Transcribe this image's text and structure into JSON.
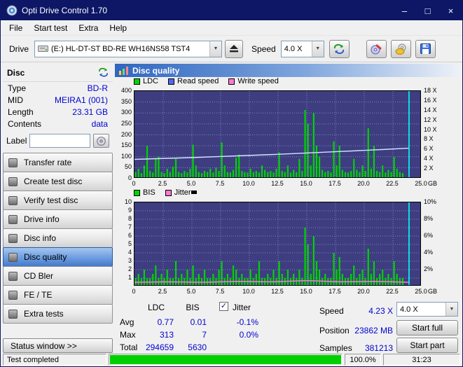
{
  "window": {
    "title": "Opti Drive Control 1.70",
    "minimize": "–",
    "maximize": "□",
    "close": "×"
  },
  "menu": {
    "items": [
      "File",
      "Start test",
      "Extra",
      "Help"
    ]
  },
  "toolbar": {
    "drive_label": "Drive",
    "drive_value": "(E:)  HL-DT-ST BD-RE  WH16NS58 TST4",
    "speed_label": "Speed",
    "speed_value": "4.0 X"
  },
  "sidebar": {
    "header": "Disc",
    "fields": [
      {
        "label": "Type",
        "value": "BD-R"
      },
      {
        "label": "MID",
        "value": "MEIRA1 (001)"
      },
      {
        "label": "Length",
        "value": "23.31 GB"
      },
      {
        "label": "Contents",
        "value": "data"
      }
    ],
    "label_field": {
      "label": "Label",
      "value": ""
    },
    "buttons": [
      {
        "label": "Transfer rate"
      },
      {
        "label": "Create test disc"
      },
      {
        "label": "Verify test disc"
      },
      {
        "label": "Drive info"
      },
      {
        "label": "Disc info"
      },
      {
        "label": "Disc quality",
        "selected": true
      },
      {
        "label": "CD Bler"
      },
      {
        "label": "FE / TE"
      },
      {
        "label": "Extra tests"
      }
    ],
    "status_window": "Status window >>"
  },
  "panel": {
    "title": "Disc quality"
  },
  "chart_data": [
    {
      "type": "bar",
      "name": "disc-quality-ldc",
      "legend": [
        {
          "label": "LDC",
          "color": "#00d400"
        },
        {
          "label": "Read speed",
          "color": "#5566ee"
        },
        {
          "label": "Write speed",
          "color": "#ff7ad2"
        }
      ],
      "xlim": [
        0,
        25
      ],
      "xticks": [
        0,
        2.5,
        5,
        7.5,
        10,
        12.5,
        15,
        17.5,
        20,
        22.5,
        25
      ],
      "x_unit": "GB",
      "left_axis": {
        "lim": [
          0,
          400
        ],
        "ticks": [
          0,
          50,
          100,
          150,
          200,
          250,
          300,
          350,
          400
        ],
        "suffix": ""
      },
      "right_axis": {
        "lim": [
          0,
          18
        ],
        "ticks": [
          2,
          4,
          6,
          8,
          10,
          12,
          14,
          16,
          18
        ],
        "suffix": " X"
      },
      "grid": {
        "x_step": 2.5,
        "y_step": 50
      },
      "bars": {
        "name": "LDC",
        "color": "#00d400",
        "x_start": 0.1,
        "x_step": 0.25,
        "values": [
          30,
          45,
          25,
          60,
          150,
          35,
          28,
          90,
          100,
          30,
          25,
          45,
          30,
          55,
          90,
          30,
          25,
          35,
          28,
          45,
          155,
          60,
          30,
          25,
          35,
          30,
          45,
          28,
          50,
          35,
          165,
          60,
          30,
          28,
          40,
          95,
          110,
          35,
          30,
          28,
          45,
          30,
          35,
          28,
          60,
          40,
          30,
          35,
          28,
          45,
          120,
          35,
          30,
          60,
          28,
          40,
          30,
          90,
          35,
          313,
          250,
          60,
          300,
          150,
          100,
          40,
          30,
          35,
          28,
          170,
          60,
          150,
          40,
          30,
          28,
          35,
          90,
          40,
          30,
          60,
          35,
          230,
          45,
          150,
          35,
          30,
          60,
          28,
          40,
          30,
          100,
          45,
          30,
          25
        ]
      },
      "lines": [
        {
          "name": "Read speed",
          "color": "#d2e4ff",
          "points": [
            [
              0,
              88
            ],
            [
              2.5,
              92
            ],
            [
              5,
              96
            ],
            [
              7.5,
              101
            ],
            [
              10,
              106
            ],
            [
              12.5,
              111
            ],
            [
              15,
              117
            ],
            [
              17.5,
              123
            ],
            [
              20,
              129
            ],
            [
              22,
              134
            ],
            [
              23.9,
              139
            ]
          ]
        }
      ],
      "end_line": {
        "x": 23.9,
        "color": "#00ffff"
      }
    },
    {
      "type": "bar",
      "name": "bis-jitter",
      "legend": [
        {
          "label": "BIS",
          "color": "#00d400"
        },
        {
          "label": "Jitter",
          "color": "#ff7ad2"
        }
      ],
      "xlim": [
        0,
        25
      ],
      "xticks": [
        0,
        2.5,
        5,
        7.5,
        10,
        12.5,
        15,
        17.5,
        20,
        22.5,
        25
      ],
      "x_unit": "GB",
      "left_axis": {
        "lim": [
          0,
          10
        ],
        "ticks": [
          1,
          2,
          3,
          4,
          5,
          6,
          7,
          8,
          9,
          10
        ],
        "suffix": ""
      },
      "right_axis": {
        "lim": [
          0,
          10
        ],
        "ticks": [
          2,
          4,
          6,
          8,
          10
        ],
        "suffix": "%"
      },
      "grid": {
        "x_step": 2.5,
        "y_step": 1
      },
      "bars": {
        "name": "BIS",
        "color": "#00d400",
        "x_start": 0.1,
        "x_step": 0.25,
        "values": [
          1,
          1.5,
          1,
          2,
          1,
          1,
          1.5,
          2.5,
          1,
          1.5,
          1,
          2,
          1,
          1,
          3,
          1,
          1.5,
          1,
          2,
          1,
          2.5,
          1,
          1.5,
          1,
          2,
          1,
          1,
          1.5,
          1,
          2,
          3,
          1,
          1.5,
          1,
          2.5,
          2,
          1,
          1.5,
          1,
          1,
          2,
          1,
          1.5,
          3,
          1,
          1,
          1.5,
          1,
          2,
          1,
          3,
          1.5,
          1,
          2,
          1,
          1.5,
          1,
          2,
          1,
          7,
          5,
          1.5,
          6,
          3,
          2,
          1,
          1.5,
          1,
          1,
          4,
          2,
          3.5,
          1.5,
          1,
          1,
          1.5,
          2.5,
          1,
          1.5,
          2,
          1,
          4.5,
          1.5,
          3,
          1,
          1.5,
          2,
          1,
          1.5,
          1,
          3,
          1.5,
          1,
          1
        ]
      },
      "lines": [
        {
          "name": "Jitter",
          "color": "#ff7ad2",
          "points": [
            [
              0,
              0.5
            ],
            [
              3,
              0.55
            ],
            [
              6,
              0.5
            ],
            [
              9,
              0.6
            ],
            [
              12,
              0.55
            ],
            [
              15,
              0.7
            ],
            [
              18,
              0.55
            ],
            [
              21,
              0.6
            ],
            [
              23.9,
              0.5
            ]
          ]
        }
      ],
      "end_line": {
        "x": 23.9,
        "color": "#00ffff"
      }
    }
  ],
  "stats": {
    "columns": {
      "ldc": "LDC",
      "bis": "BIS",
      "jitter": "Jitter"
    },
    "jitter_checked": true,
    "rows": [
      {
        "label": "Avg",
        "ldc": "0.77",
        "bis": "0.01",
        "jitter": "-0.1%"
      },
      {
        "label": "Max",
        "ldc": "313",
        "bis": "7",
        "jitter": "0.0%"
      },
      {
        "label": "Total",
        "ldc": "294659",
        "bis": "5630",
        "jitter": ""
      }
    ],
    "speed_label": "Speed",
    "speed_value": "4.23 X",
    "position_label": "Position",
    "position_value": "23862 MB",
    "samples_label": "Samples",
    "samples_value": "381213",
    "speed_select": "4.0 X",
    "start_full": "Start full",
    "start_part": "Start part"
  },
  "statusbar": {
    "status": "Test completed",
    "progress_percent": "100.0%",
    "time": "31:23"
  },
  "colors": {
    "chart_bg": "#3d3d80",
    "grid": "#8080c8",
    "value_blue": "#0000d2",
    "progress_green": "#00cf00",
    "cyan": "#00ffff"
  }
}
